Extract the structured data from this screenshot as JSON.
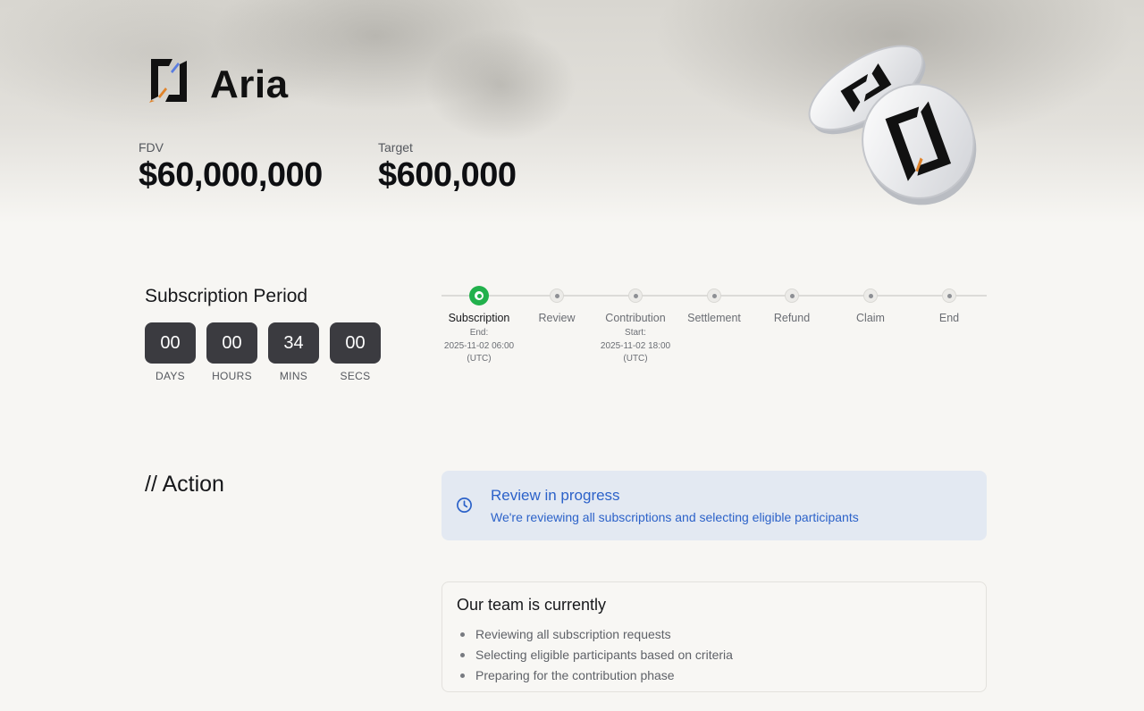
{
  "project": {
    "name": "Aria",
    "logo_icon": "aria-logo-icon"
  },
  "stats": {
    "fdv": {
      "label": "FDV",
      "value": "$60,000,000"
    },
    "target": {
      "label": "Target",
      "value": "$600,000"
    }
  },
  "subscription": {
    "title": "Subscription Period",
    "countdown": [
      {
        "value": "00",
        "label": "DAYS"
      },
      {
        "value": "00",
        "label": "HOURS"
      },
      {
        "value": "34",
        "label": "MINS"
      },
      {
        "value": "00",
        "label": "SECS"
      }
    ]
  },
  "timeline": {
    "steps": [
      {
        "label": "Subscription",
        "sub": [
          "End:",
          "2025-11-02 06:00",
          "(UTC)"
        ],
        "active": true
      },
      {
        "label": "Review",
        "sub": []
      },
      {
        "label": "Contribution",
        "sub": [
          "Start:",
          "2025-11-02 18:00",
          "(UTC)"
        ]
      },
      {
        "label": "Settlement",
        "sub": []
      },
      {
        "label": "Refund",
        "sub": []
      },
      {
        "label": "Claim",
        "sub": []
      },
      {
        "label": "End",
        "sub": []
      }
    ]
  },
  "action": {
    "title": "// Action",
    "review": {
      "icon": "clock-icon",
      "title": "Review in progress",
      "subtitle": "We're reviewing all subscriptions and selecting eligible participants"
    },
    "team": {
      "title": "Our team is currently",
      "items": [
        "Reviewing all subscription requests",
        "Selecting eligible participants based on criteria",
        "Preparing for the contribution phase"
      ]
    }
  },
  "colors": {
    "accent_blue": "#2c62c9",
    "active_green": "#22b14c",
    "countdown_bg": "#3b3b40",
    "review_bg": "#e3e9f2"
  }
}
